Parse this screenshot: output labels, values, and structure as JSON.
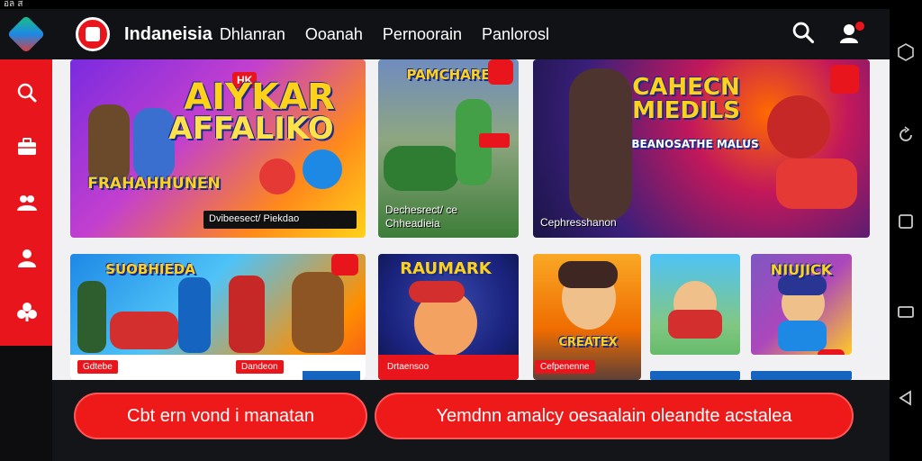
{
  "status_bar": {
    "text": "อ่ล ส"
  },
  "header": {
    "brand": "Indaneisia",
    "nav": [
      "Dhlanran",
      "Ooanah",
      "Pernoorain",
      "Panlorosl"
    ]
  },
  "sidebar": {
    "items": [
      "search-icon",
      "briefcase-icon",
      "users-icon",
      "user-icon",
      "clubs-icon"
    ]
  },
  "cards": {
    "c1": {
      "title_top": "AIYKAR",
      "title_bottom": "AFFALIKO",
      "title_hk": "HK",
      "sub_title": "FRAHAHHUNEN",
      "caption": "Dvibeesect/ Piekdao"
    },
    "c2": {
      "title": "PAMCHARE",
      "caption": "Dechesrect/ ce Chheadieia"
    },
    "c3": {
      "title": "CAHECN MIEDILS",
      "subtitle": "BEANOSATHE MALUS",
      "caption": "Cephresshanon"
    },
    "c4": {
      "title": "SUOBHIEDA",
      "tags": [
        "Gdtebe",
        "Dandeon"
      ]
    },
    "c5": {
      "title": "RAUMARK",
      "tag": "Drtaensoo"
    },
    "c6": {
      "title": "CREATEX",
      "tag": "Cefpenenne"
    },
    "c7": {
      "title": ""
    },
    "c8": {
      "title": "NIUJICK"
    }
  },
  "bottom": {
    "left_button": "Cbt ern vond i manatan",
    "right_button": "Yemdnn amalcy oesaalain oleandte acstalea"
  },
  "colors": {
    "accent": "#e8161c",
    "header_bg": "#111216",
    "content_bg": "#f1f1f3"
  }
}
